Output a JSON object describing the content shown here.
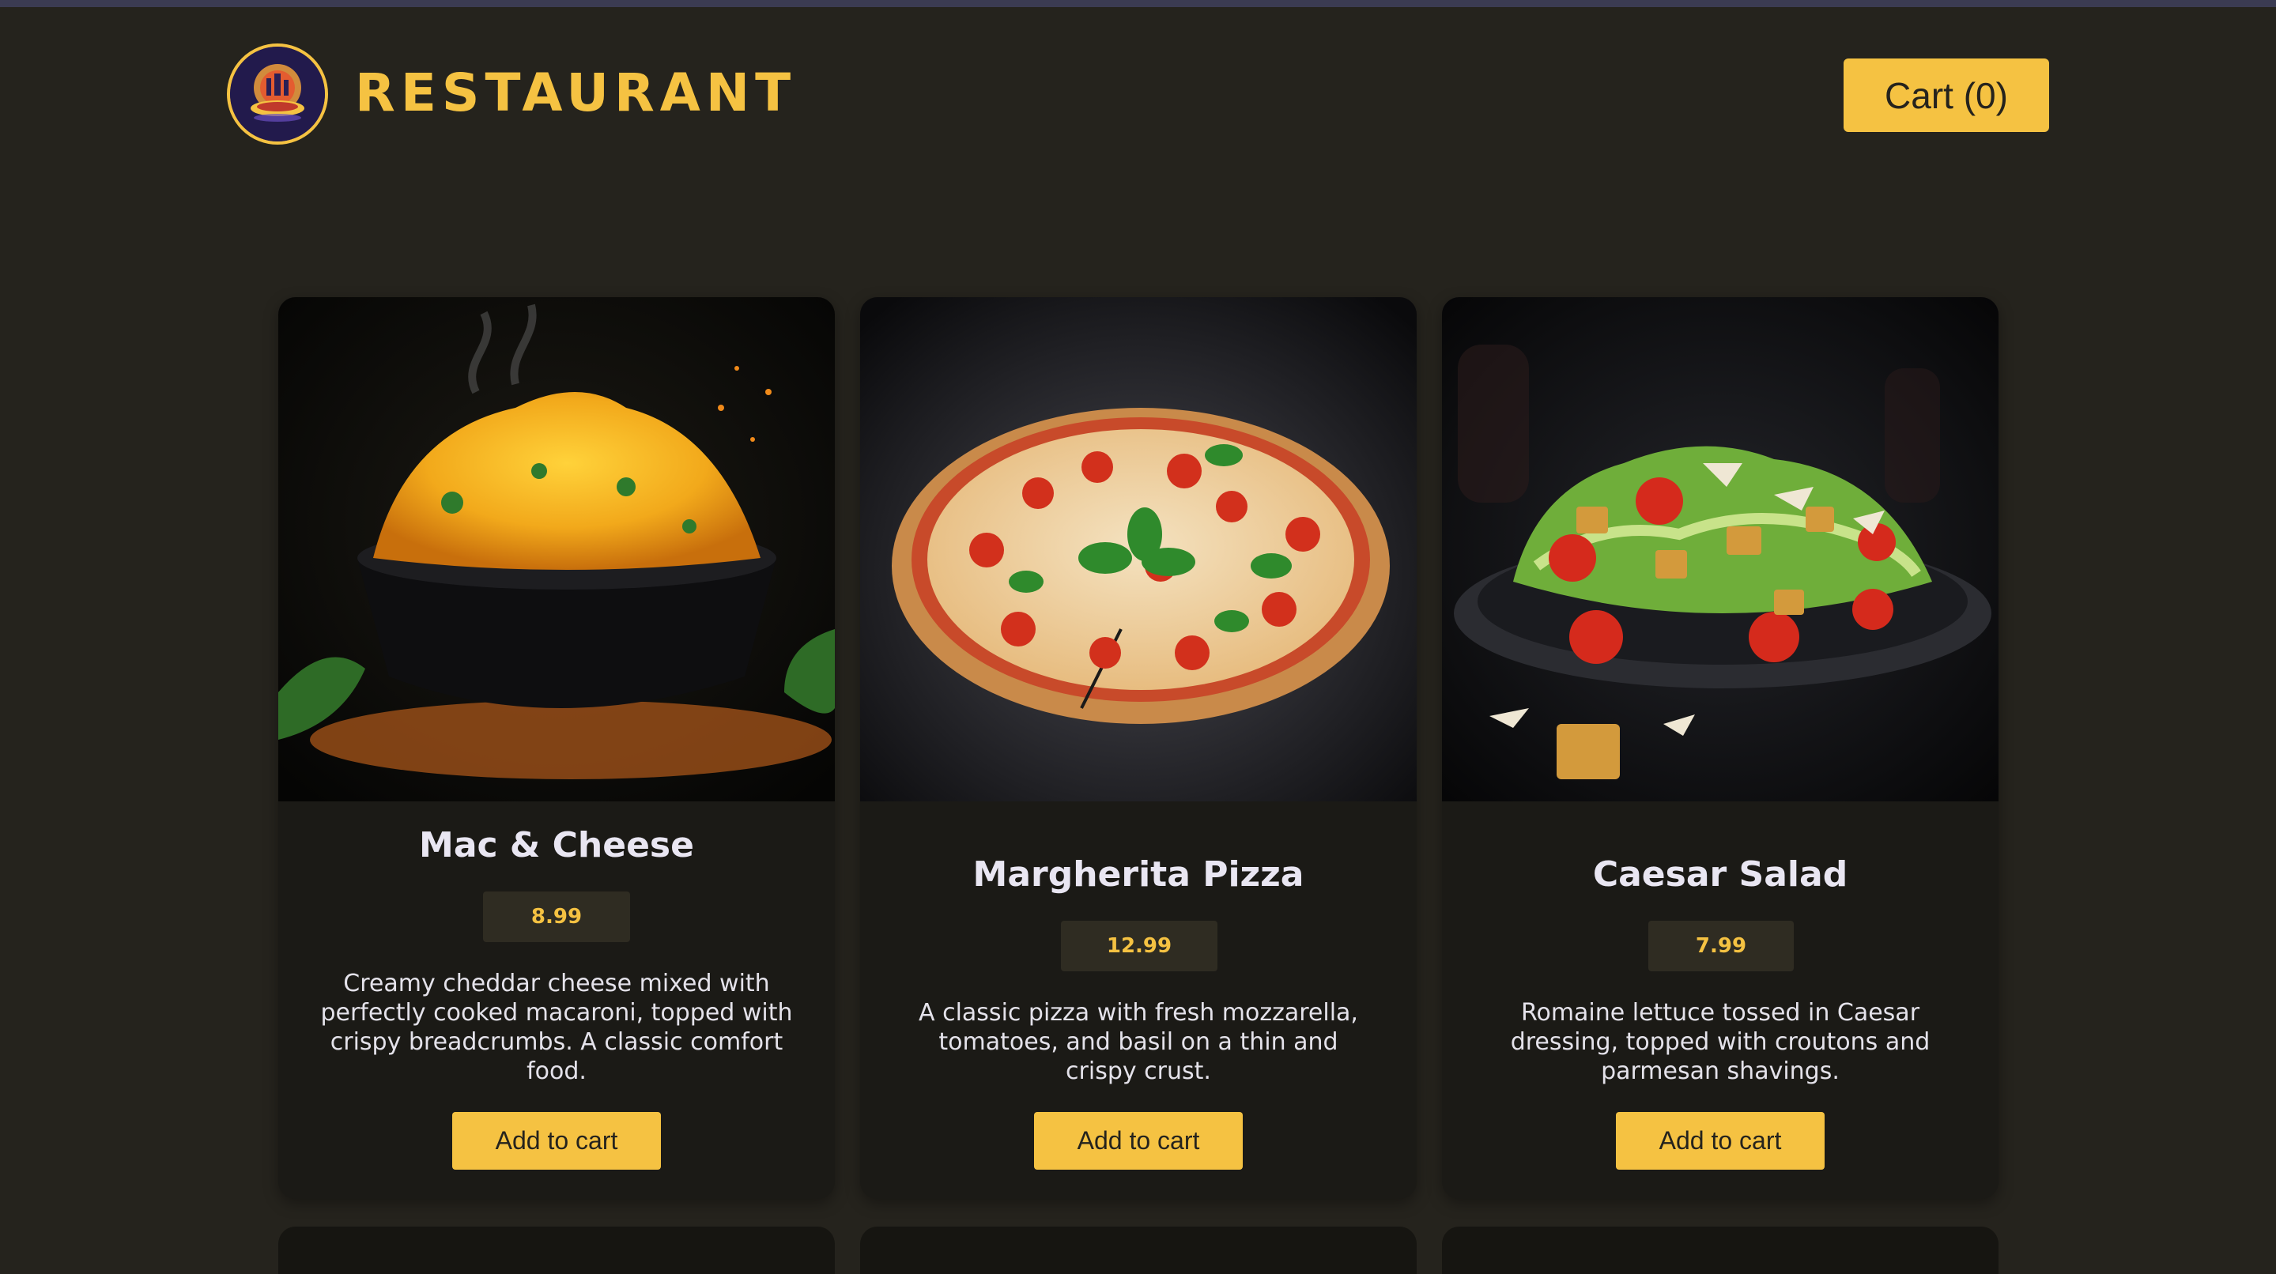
{
  "header": {
    "brand": "RESTAURANT",
    "cart_label": "Cart (0)"
  },
  "menu": {
    "items": [
      {
        "name": "Mac & Cheese",
        "price": "8.99",
        "description": "Creamy cheddar cheese mixed with perfectly cooked macaroni, topped with crispy breadcrumbs. A classic comfort food.",
        "button": "Add to cart",
        "image": "mac-and-cheese-photo"
      },
      {
        "name": "Margherita Pizza",
        "price": "12.99",
        "description": "A classic pizza with fresh mozzarella, tomatoes, and basil on a thin and crispy crust.",
        "button": "Add to cart",
        "image": "margherita-pizza-photo"
      },
      {
        "name": "Caesar Salad",
        "price": "7.99",
        "description": "Romaine lettuce tossed in Caesar dressing, topped with croutons and parmesan shavings.",
        "button": "Add to cart",
        "image": "caesar-salad-photo"
      }
    ]
  },
  "colors": {
    "background": "#25231d",
    "card": "#1b1a16",
    "accent": "#f5c242",
    "price_badge": "#2f2c22",
    "text": "#e9e6f2"
  }
}
